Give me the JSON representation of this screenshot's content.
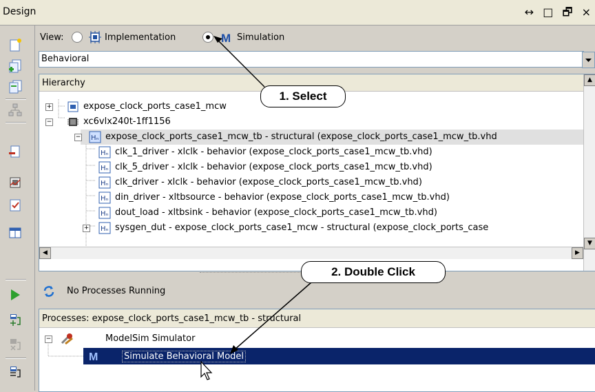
{
  "panel": {
    "title": "Design",
    "controls": "↔ □ 🗗 ×"
  },
  "view": {
    "label": "View:",
    "options": [
      "Implementation",
      "Simulation"
    ],
    "selected": "Simulation"
  },
  "view_dropdown": {
    "value": "Behavioral"
  },
  "hierarchy": {
    "header": "Hierarchy",
    "items": [
      {
        "label": "expose_clock_ports_case1_mcw",
        "level": 0
      },
      {
        "label": "xc6vlx240t-1ff1156",
        "level": 0
      },
      {
        "label": "expose_clock_ports_case1_mcw_tb - structural (expose_clock_ports_case1_mcw_tb.vhd",
        "level": 1
      },
      {
        "label": "clk_1_driver - xlclk - behavior (expose_clock_ports_case1_mcw_tb.vhd)",
        "level": 2
      },
      {
        "label": "clk_5_driver - xlclk - behavior (expose_clock_ports_case1_mcw_tb.vhd)",
        "level": 2
      },
      {
        "label": "clk_driver - xlclk - behavior (expose_clock_ports_case1_mcw_tb.vhd)",
        "level": 2
      },
      {
        "label": "din_driver - xltbsource - behavior (expose_clock_ports_case1_mcw_tb.vhd)",
        "level": 2
      },
      {
        "label": "dout_load - xltbsink - behavior (expose_clock_ports_case1_mcw_tb.vhd)",
        "level": 2
      },
      {
        "label": "sysgen_dut - expose_clock_ports_case1_mcw - structural (expose_clock_ports_case",
        "level": 2
      }
    ]
  },
  "process_status": {
    "text": "No Processes Running"
  },
  "processes": {
    "header": "Processes: expose_clock_ports_case1_mcw_tb - structural",
    "items": [
      {
        "label": "ModelSim Simulator"
      },
      {
        "label": "Simulate Behavioral Model"
      }
    ]
  },
  "callouts": {
    "select": "1. Select",
    "double_click": "2. Double Click"
  },
  "colors": {
    "selection": "#0a246a",
    "accent_blue": "#1e4fa8",
    "play_green": "#2ea02e"
  }
}
